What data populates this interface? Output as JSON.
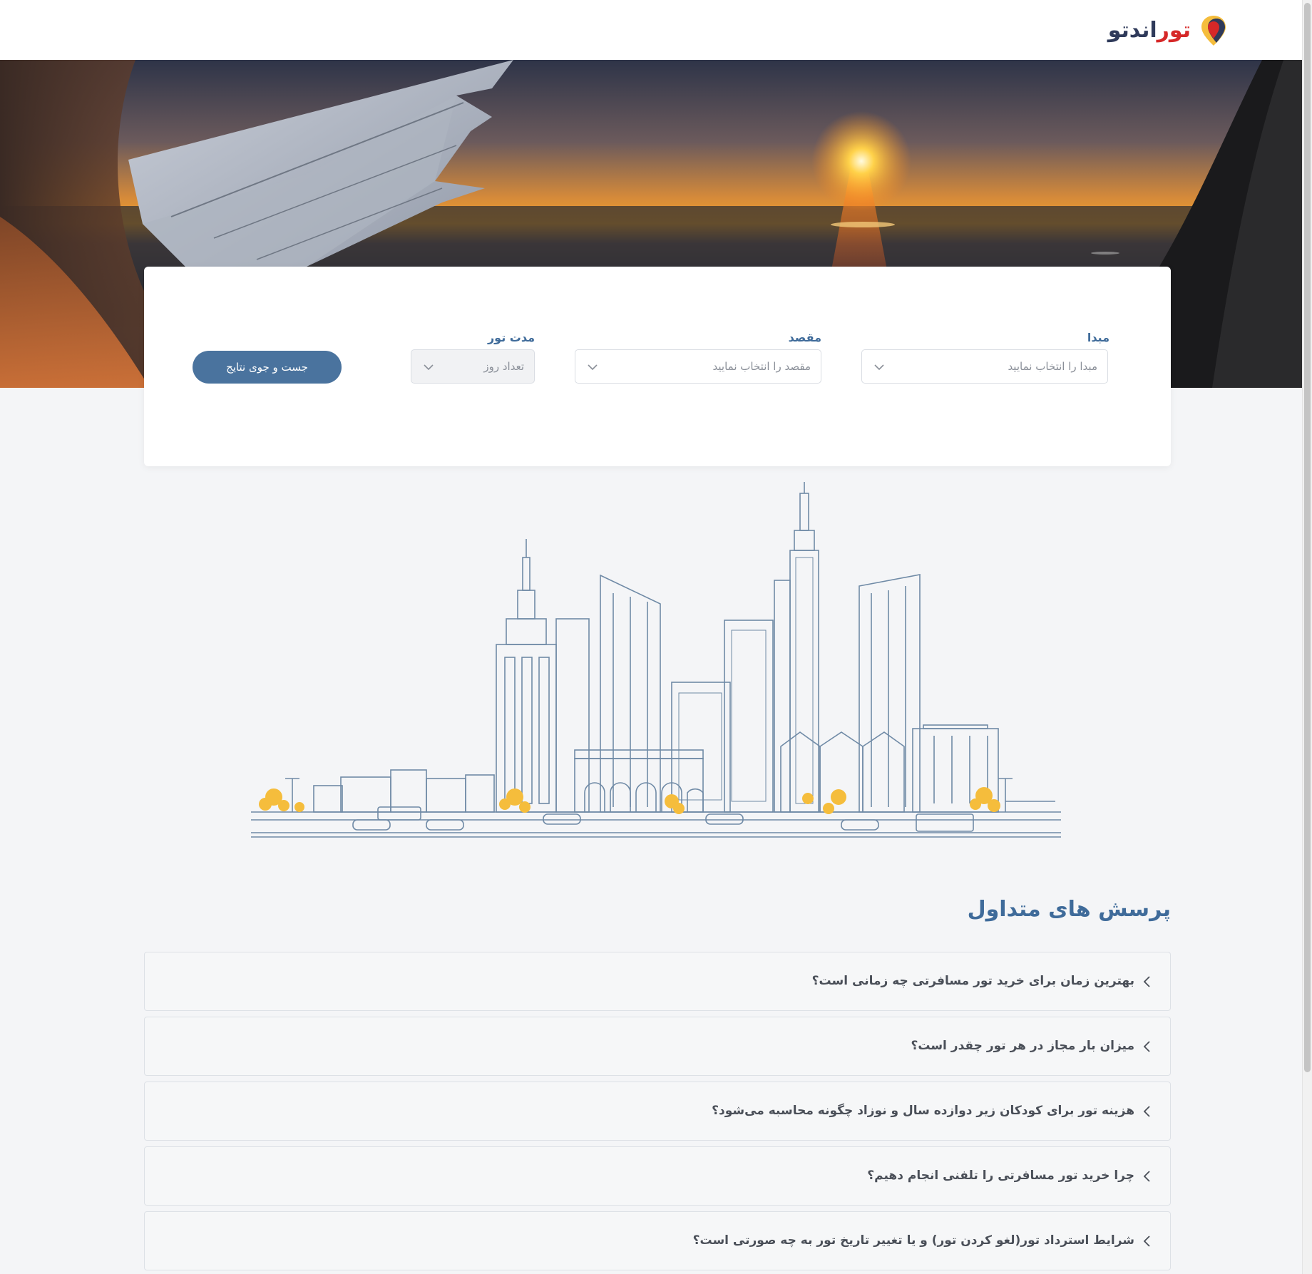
{
  "brand": {
    "logo_part1": "تور",
    "logo_part2": "اندتو"
  },
  "search": {
    "origin_label": "مبدا",
    "origin_placeholder": "مبدا را انتخاب نمایید",
    "destination_label": "مقصد",
    "destination_placeholder": "مقصد را انتخاب نمایید",
    "duration_label": "مدت تور",
    "duration_placeholder": "تعداد روز",
    "submit_label": "جست و جوی نتایج"
  },
  "faq": {
    "title": "پرسش های متداول",
    "items": [
      {
        "question": "بهترین زمان برای خرید تور مسافرتی چه زمانی است؟"
      },
      {
        "question": "میزان بار مجاز در هر تور چقدر است؟"
      },
      {
        "question": "هزینه تور برای کودکان زیر دوازده سال و نوزاد چگونه محاسبه می‌شود؟"
      },
      {
        "question": "چرا خرید تور مسافرتی را تلفنی انجام دهیم؟"
      },
      {
        "question": "شرایط استرداد تور(لغو کردن تور) و یا تغییر تاریخ تور به چه صورتی است؟"
      }
    ]
  },
  "colors": {
    "accent": "#4a739e",
    "heading": "#3f6b9a",
    "logo_red": "#d62828",
    "logo_dark": "#2f3a5a",
    "skyline_stroke": "#6f8aa6",
    "tree": "#f5bd3c"
  },
  "icons": {
    "logo": "map-pin-icon",
    "select": "chevron-down-icon",
    "faq": "chevron-left-icon"
  }
}
